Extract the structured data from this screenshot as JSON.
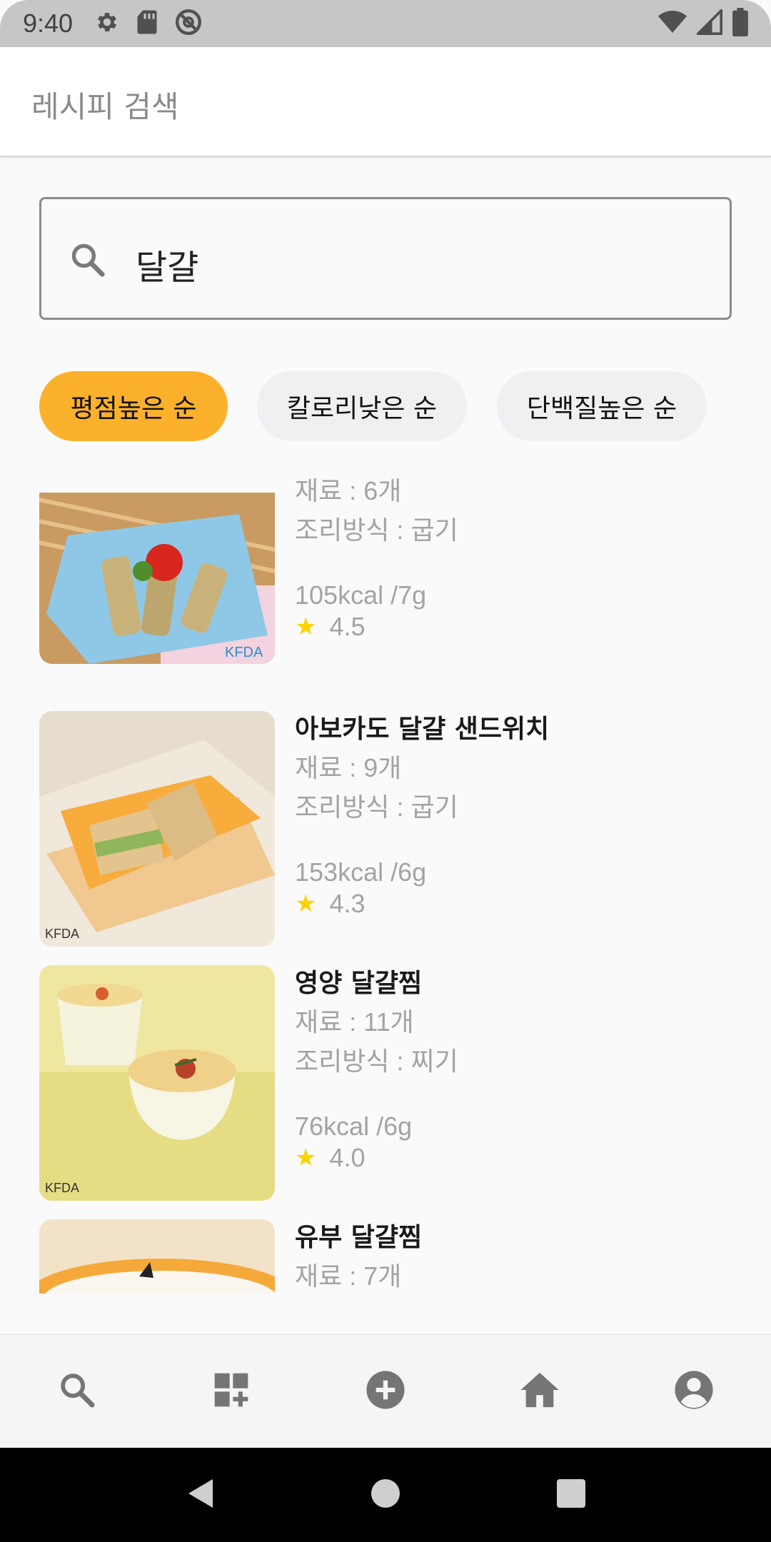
{
  "status_bar": {
    "time": "9:40",
    "left_icons": [
      "gear-icon",
      "sd-card-icon",
      "at-sign-icon"
    ],
    "right_icons": [
      "wifi-icon",
      "signal-icon",
      "battery-icon"
    ]
  },
  "app_bar": {
    "title": "레시피 검색"
  },
  "search": {
    "value": "달걀",
    "icon": "search-icon"
  },
  "sort_chips": [
    {
      "label": "평점높은 순",
      "active": true
    },
    {
      "label": "칼로리낮은 순",
      "active": false
    },
    {
      "label": "단백질높은 순",
      "active": false
    }
  ],
  "recipes": [
    {
      "title": "",
      "ingredients": "재료 : 6개",
      "method": "조리방식 : 굽기",
      "nutrition": "105kcal /7g",
      "rating": "4.5"
    },
    {
      "title": "아보카도 달걀 샌드위치",
      "ingredients": "재료 : 9개",
      "method": "조리방식 : 굽기",
      "nutrition": "153kcal /6g",
      "rating": "4.3"
    },
    {
      "title": "영양 달걀찜",
      "ingredients": "재료 : 11개",
      "method": "조리방식 : 찌기",
      "nutrition": "76kcal /6g",
      "rating": "4.0"
    },
    {
      "title": "유부 달걀찜",
      "ingredients": "재료 : 7개"
    }
  ],
  "bottom_nav": [
    "search-icon",
    "add-widget-icon",
    "add-circle-icon",
    "home-icon",
    "account-icon"
  ],
  "system_nav": [
    "back-icon",
    "home-circle-icon",
    "recents-icon"
  ],
  "colors": {
    "accent": "#fbb12c",
    "star": "#fbd400",
    "chip_inactive": "#eff0f2"
  }
}
